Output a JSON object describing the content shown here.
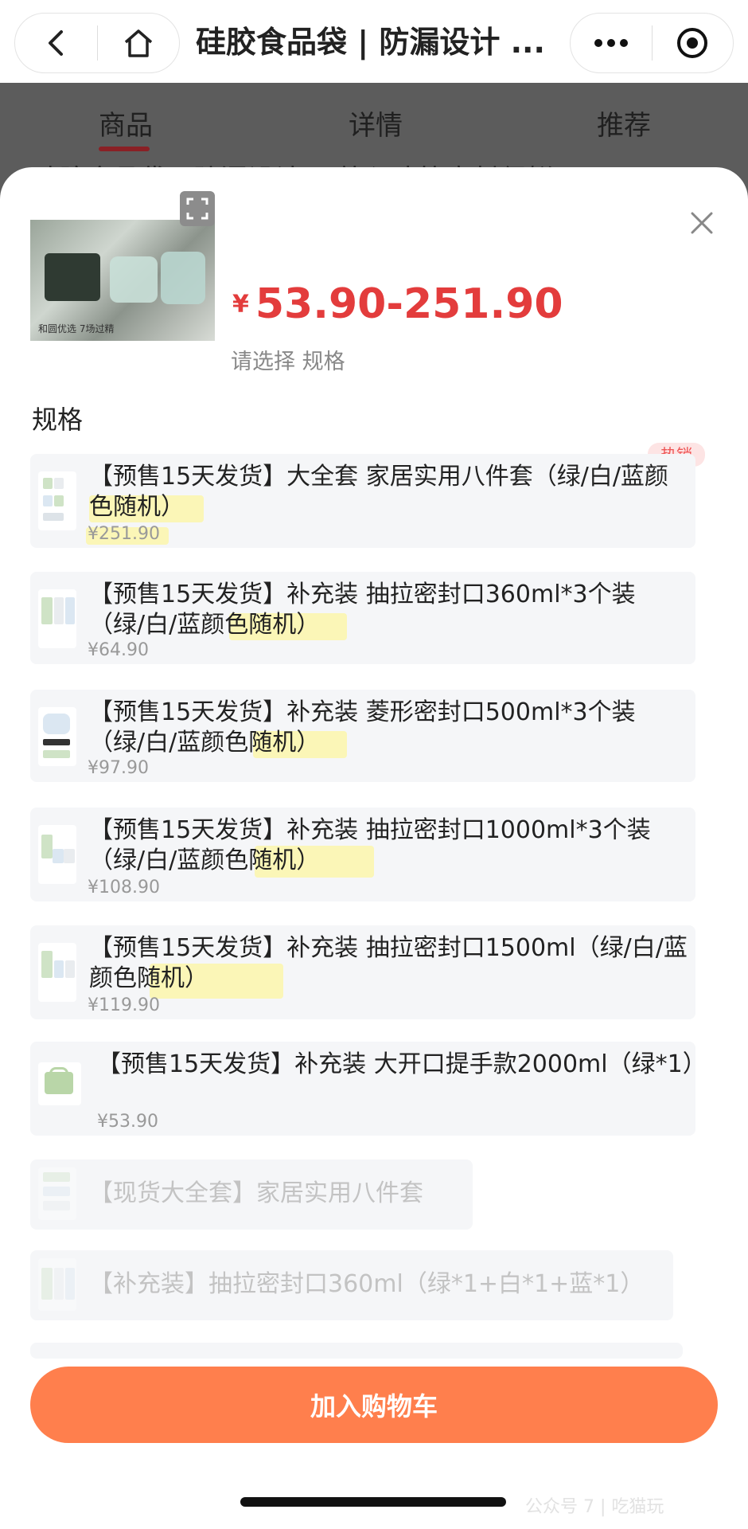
{
  "nav": {
    "title": "硅胶食品袋 | 防漏设计 ..."
  },
  "tabs": [
    {
      "label": "商品"
    },
    {
      "label": "详情"
    },
    {
      "label": "推荐"
    }
  ],
  "behind_text": "硅胶食品袋 | 防漏设计 可放入冰箱密封保鲜",
  "sheet": {
    "currency": "¥",
    "price": "53.90-251.90",
    "hint": "请选择 规格",
    "spec_title": "规格",
    "hot_badge": "热销",
    "thumb_caption": "和圆优选 7场过精",
    "items": [
      {
        "label": "【预售15天发货】大全套 家居实用八件套（绿/白/蓝颜色随机）",
        "price": "¥251.90"
      },
      {
        "label": "【预售15天发货】补充装 抽拉密封口360ml*3个装（绿/白/蓝颜色随机）",
        "price": "¥64.90"
      },
      {
        "label": "【预售15天发货】补充装 菱形密封口500ml*3个装（绿/白/蓝颜色随机）",
        "price": "¥97.90"
      },
      {
        "label": "【预售15天发货】补充装 抽拉密封口1000ml*3个装（绿/白/蓝颜色随机）",
        "price": "¥108.90"
      },
      {
        "label": "【预售15天发货】补充装 抽拉密封口1500ml（绿/白/蓝颜色随机）",
        "price": "¥119.90"
      },
      {
        "label": "【预售15天发货】补充装 大开口提手款2000ml（绿*1）",
        "price": "¥53.90"
      },
      {
        "label": "【现货大全套】家居实用八件套",
        "price": ""
      },
      {
        "label": "【补充装】抽拉密封口360ml（绿*1+白*1+蓝*1）",
        "price": ""
      }
    ],
    "cart_label": "加入购物车"
  },
  "watermark": "公众号 7 | 吃猫玩",
  "colors": {
    "price": "#e33c3c",
    "cart_button": "#ff7f4d",
    "tab_active": "#8a2025"
  }
}
